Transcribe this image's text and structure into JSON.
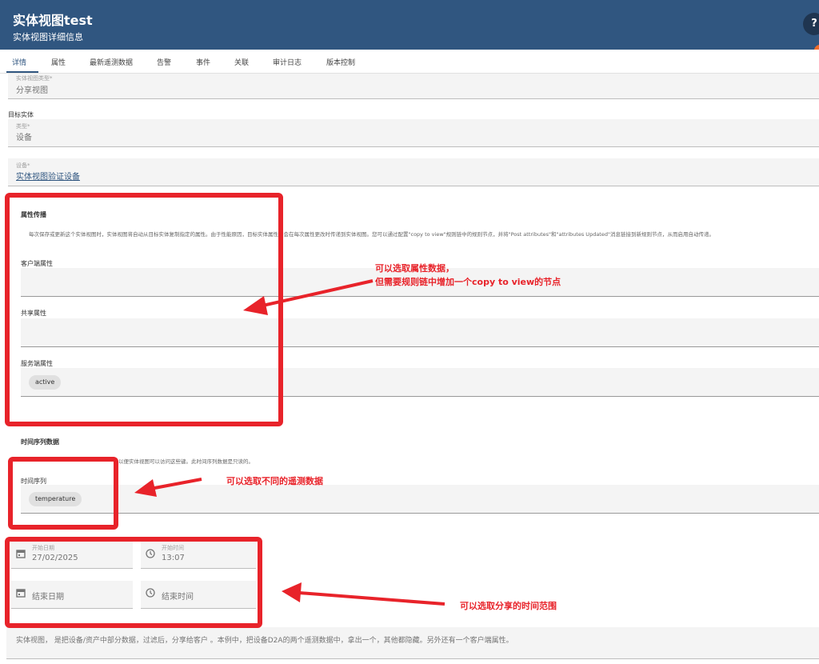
{
  "header": {
    "title": "实体视图test",
    "subtitle": "实体视图详细信息",
    "help_icon": "?"
  },
  "tabs": [
    {
      "label": "详情",
      "active": true
    },
    {
      "label": "属性"
    },
    {
      "label": "最新遥测数据"
    },
    {
      "label": "告警"
    },
    {
      "label": "事件"
    },
    {
      "label": "关联"
    },
    {
      "label": "审计日志"
    },
    {
      "label": "版本控制"
    }
  ],
  "entity_view_type": {
    "label": "实体视图类型*",
    "value": "分享视图"
  },
  "target_entity": {
    "section_label": "目标实体",
    "type": {
      "label": "类型*",
      "value": "设备"
    },
    "device": {
      "label": "设备*",
      "value": "实体视图验证设备"
    }
  },
  "attributes": {
    "title": "属性传播",
    "description": "每次保存或更新这个实体视图时，实体视图将自动从目标实体复制指定的属性。由于性能原因，目标实体属性不会在每次属性更改时传递到实体视图。您可以通过配置\"copy to view\"规则链中的规则节点，并将\"Post attributes\"和\"attributes Updated\"消息链接到新规则节点，从而启用自动传递。",
    "client_label": "客户端属性",
    "shared_label": "共享属性",
    "server_label": "服务端属性",
    "server_chips": [
      "active"
    ]
  },
  "timeseries": {
    "title": "时间序列数据",
    "description": "以便实体视图可以访问这些键。此时间序列数据是只读的。",
    "label": "时间序列",
    "chips": [
      "temperature"
    ]
  },
  "time_range": {
    "start_date_label": "开始日期",
    "start_date": "27/02/2025",
    "start_time_label": "开始时间",
    "start_time": "13:07",
    "end_date_placeholder": "结束日期",
    "end_time_placeholder": "结束时间"
  },
  "description_field": "实体视图，  是把设备/资产中部分数据，过滤后，分享给客户 。本例中，把设备D2A的两个遥测数据中，拿出一个，其他都隐藏。另外还有一个客户端属性。",
  "annotations": {
    "attr_line1": "可以选取属性数据，",
    "attr_line2": "但需要规则链中增加一个copy to view的节点",
    "telemetry": "可以选取不同的遥测数据",
    "time": "可以选取分享的时间范围"
  },
  "colors": {
    "header_bg": "#305680",
    "annotation_red": "#e8232a",
    "accent": "#305680"
  }
}
